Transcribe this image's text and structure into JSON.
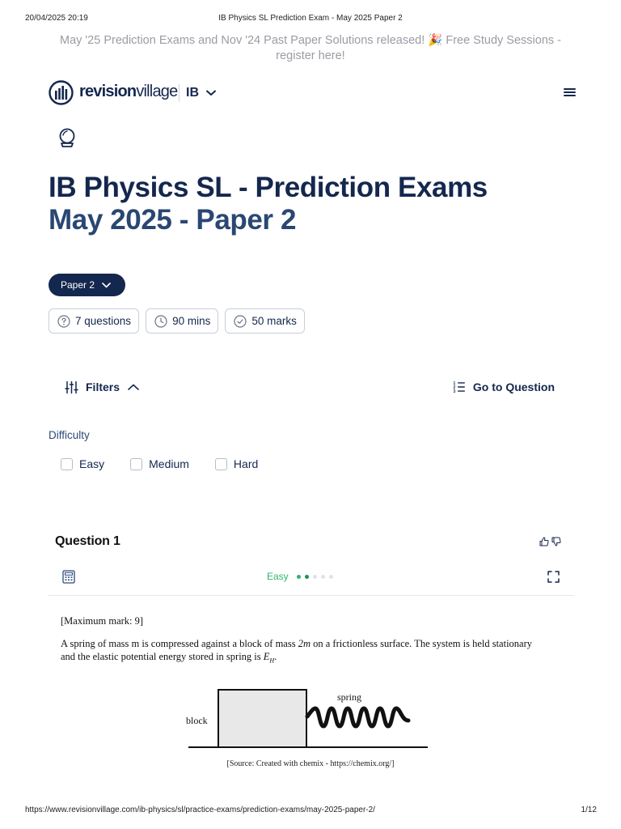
{
  "print_header": {
    "timestamp": "20/04/2025 20:19",
    "title": "IB Physics SL Prediction Exam - May 2025 Paper 2"
  },
  "banner": {
    "text": "May '25 Prediction Exams and Nov '24 Past Paper Solutions released! 🎉 Free Study Sessions - register here!"
  },
  "nav": {
    "brand_bold": "revision",
    "brand_rest": "village",
    "curriculum": "IB",
    "icons": {
      "logo": "revisionvillage-logo",
      "menu": "hamburger-menu-icon",
      "dropdown": "chevron-down-icon"
    }
  },
  "page": {
    "icon": "crystal-ball-icon",
    "title_line1": "IB Physics SL - Prediction Exams",
    "title_line2": "May 2025 - Paper 2"
  },
  "paper_select": {
    "label": "Paper 2"
  },
  "meta": {
    "questions": "7 questions",
    "duration": "90 mins",
    "marks": "50 marks"
  },
  "filters": {
    "label": "Filters",
    "goto_label": "Go to Question",
    "difficulty_label": "Difficulty",
    "options": [
      "Easy",
      "Medium",
      "Hard"
    ]
  },
  "question": {
    "heading": "Question 1",
    "difficulty": "Easy",
    "difficulty_level": 2,
    "difficulty_max": 5,
    "max_mark": "[Maximum mark: 9]",
    "text_a": "A spring of mass m is compressed against a block of mass ",
    "text_mass": "2m",
    "text_b": " on a frictionless surface. The system is held stationary and the elastic potential energy stored in spring is ",
    "text_energy": "E",
    "text_energy_sub": "H",
    "text_end": ".",
    "diagram": {
      "block_label": "block",
      "spring_label": "spring"
    },
    "source": "[Source: Created with chemix - https://chemix.org/]"
  },
  "colors": {
    "navy": "#14274e",
    "title_secondary": "#2a4773",
    "easy_green": "#2fb46c",
    "banner_grey": "#9a9ca3"
  },
  "print_footer": {
    "url": "https://www.revisionvillage.com/ib-physics/sl/practice-exams/prediction-exams/may-2025-paper-2/",
    "page": "1/12"
  }
}
